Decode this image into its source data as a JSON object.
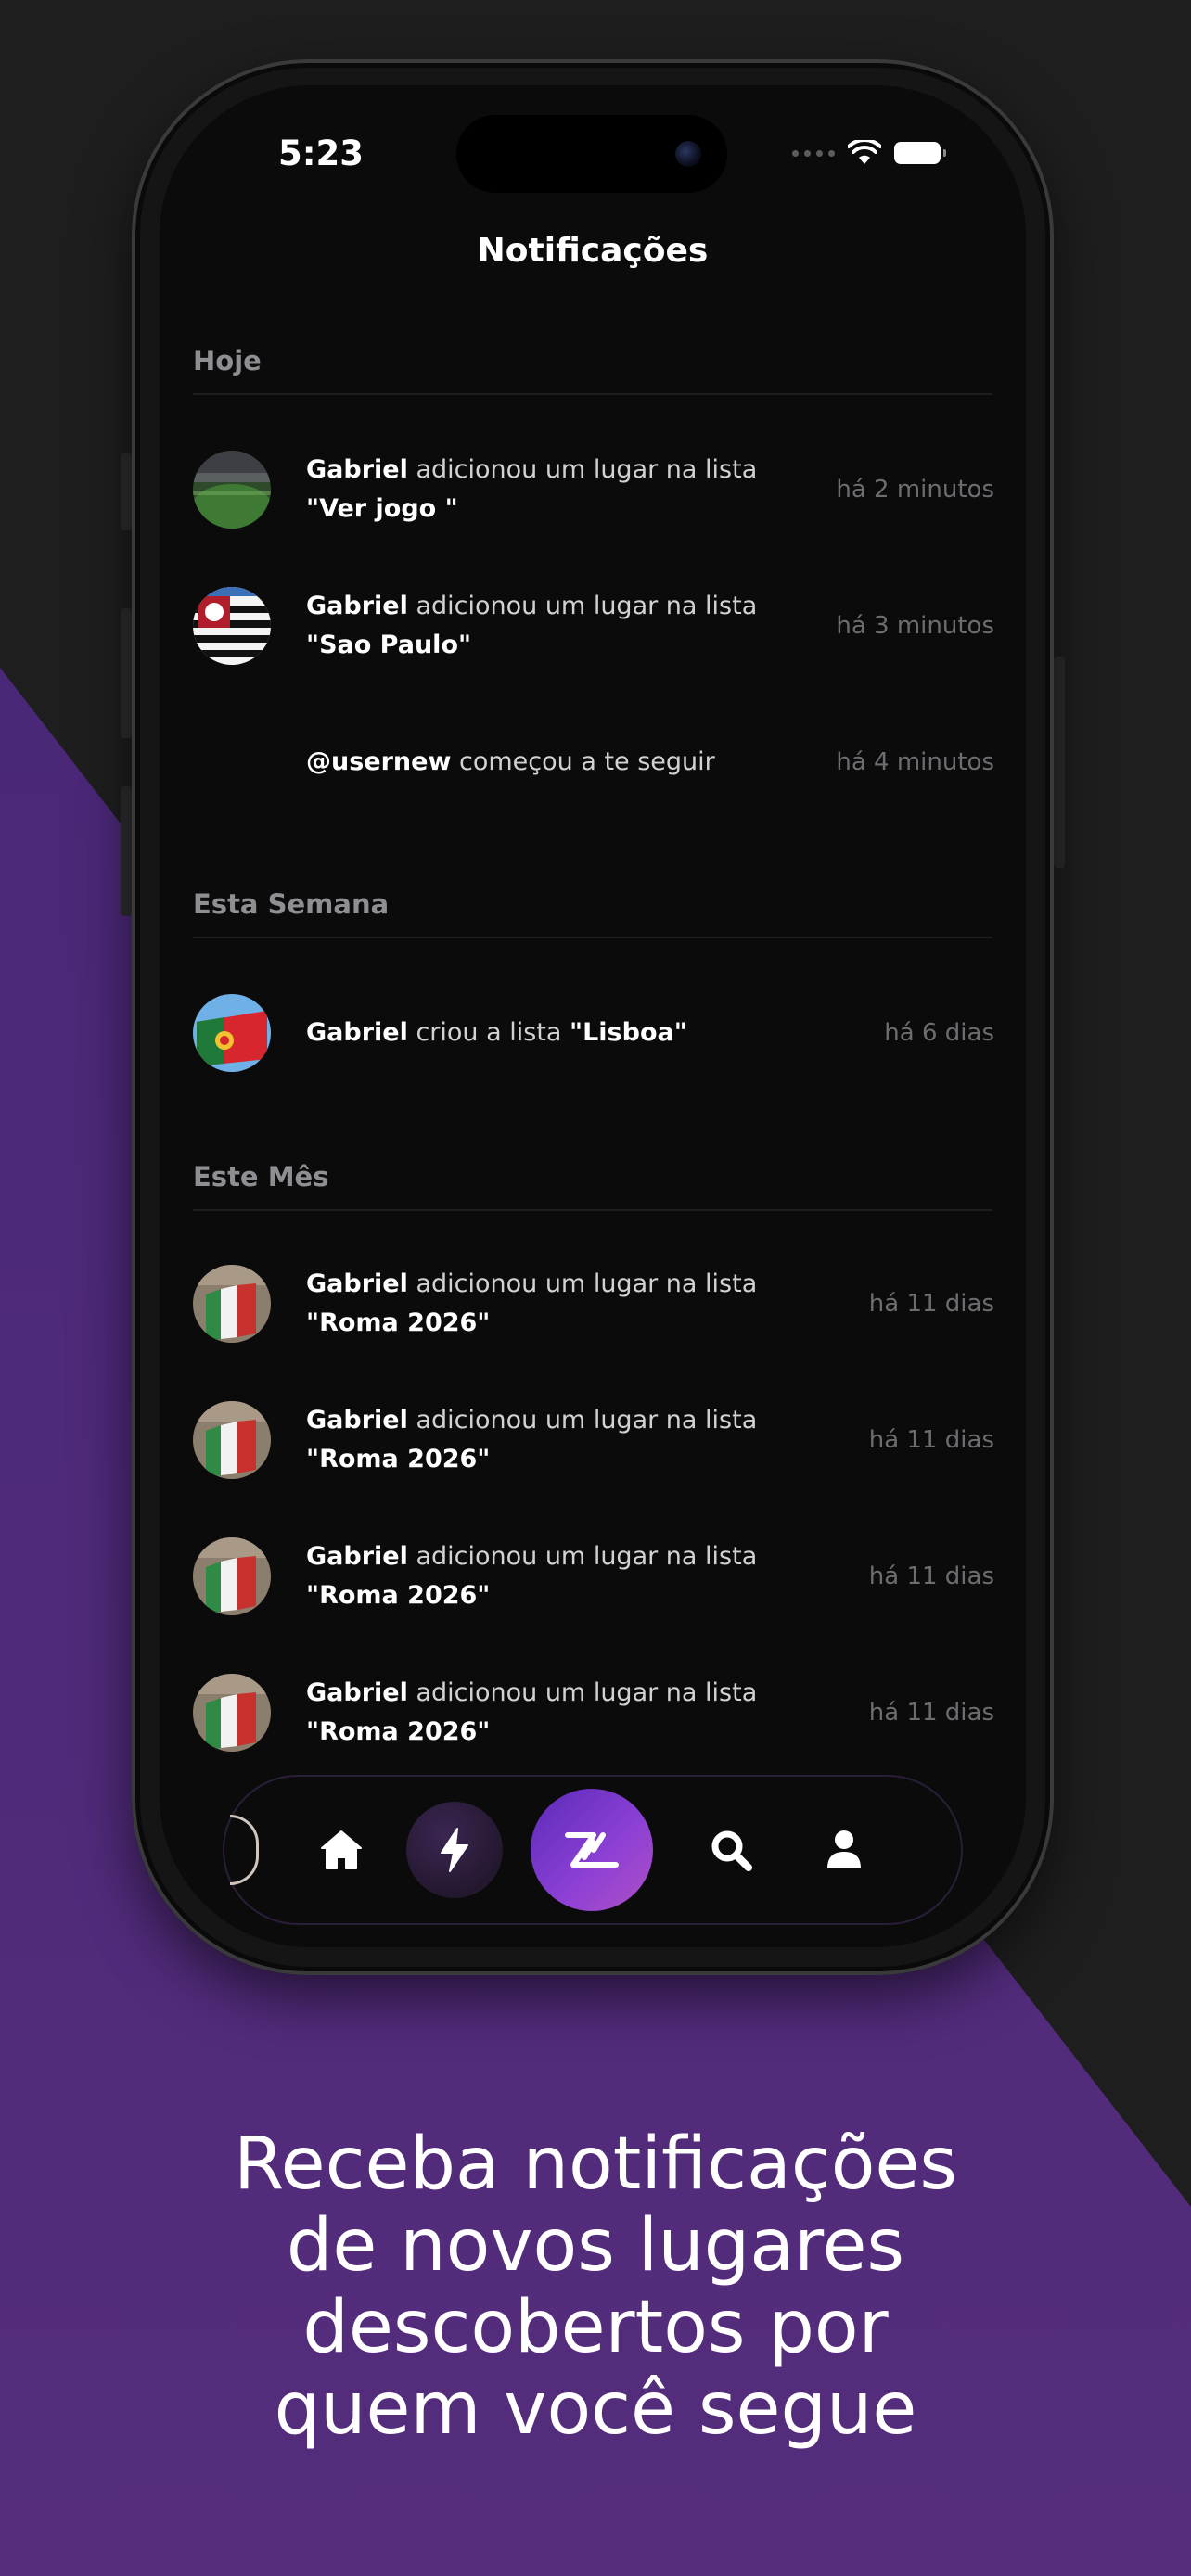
{
  "status_bar": {
    "time": "5:23"
  },
  "screen_title": "Notificações",
  "sections": [
    {
      "label": "Hoje",
      "items": [
        {
          "user": "Gabriel",
          "action": " adicionou um lugar na lista",
          "target": "\"Ver jogo \"",
          "time": "há 2 minutos",
          "avatar": "stadium-photo"
        },
        {
          "user": "Gabriel",
          "action": " adicionou um lugar na lista",
          "target": "\"Sao Paulo\"",
          "time": "há 3 minutos",
          "avatar": "sao-paulo-flag"
        },
        {
          "user": "@usernew",
          "action": " começou a te seguir",
          "target": "",
          "time": "há 4 minutos",
          "avatar": ""
        }
      ]
    },
    {
      "label": "Esta Semana",
      "items": [
        {
          "user": "Gabriel",
          "action": " criou a lista ",
          "target": "\"Lisboa\"",
          "time": "há 6 dias",
          "avatar": "portugal-flag"
        }
      ]
    },
    {
      "label": "Este Mês",
      "items": [
        {
          "user": "Gabriel",
          "action": " adicionou um lugar na lista",
          "target": "\"Roma 2026\"",
          "time": "há 11 dias",
          "avatar": "italy-flag"
        },
        {
          "user": "Gabriel",
          "action": " adicionou um lugar na lista",
          "target": "\"Roma 2026\"",
          "time": "há 11 dias",
          "avatar": "italy-flag"
        },
        {
          "user": "Gabriel",
          "action": " adicionou um lugar na lista",
          "target": "\"Roma 2026\"",
          "time": "há 11 dias",
          "avatar": "italy-flag"
        },
        {
          "user": "Gabriel",
          "action": " adicionou um lugar na lista",
          "target": "\"Roma 2026\"",
          "time": "há 11 dias",
          "avatar": "italy-flag"
        }
      ]
    }
  ],
  "tab_bar": {
    "items": [
      {
        "icon": "home-icon"
      },
      {
        "icon": "bolt-icon"
      },
      {
        "icon": "app-logo-icon"
      },
      {
        "icon": "search-icon"
      },
      {
        "icon": "profile-icon"
      }
    ]
  },
  "caption": {
    "line1": "Receba notificações",
    "line2": "de novos lugares",
    "line3": "descobertos por",
    "line4": "quem você segue"
  },
  "colors": {
    "background": "#1e1e1f",
    "purple": "#4d2a7a",
    "accent": "#8a3fd4",
    "screen": "#0b0b0b"
  }
}
